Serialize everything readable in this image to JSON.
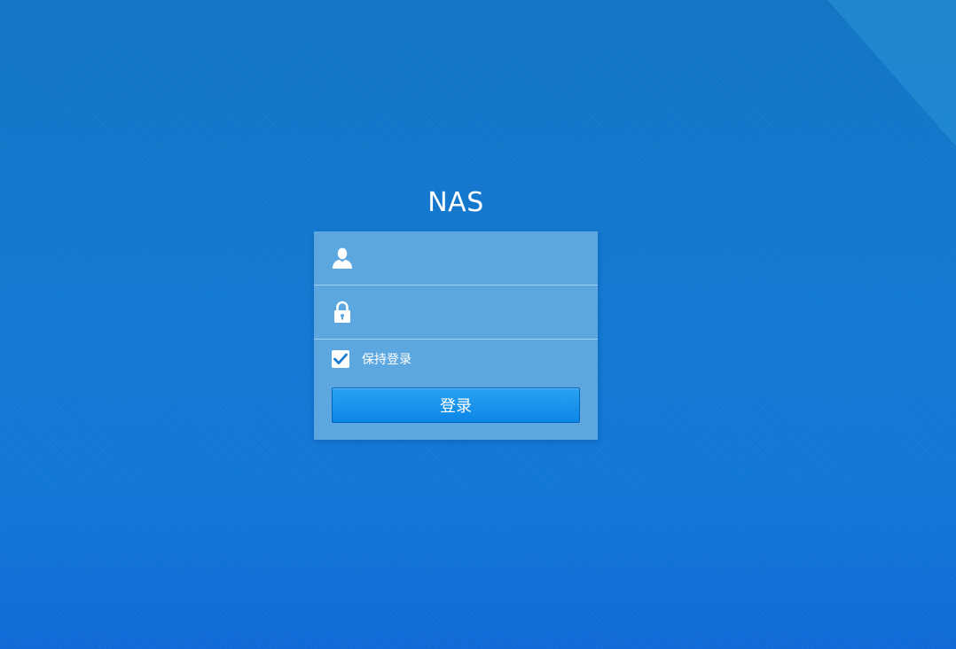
{
  "app": {
    "title": "NAS"
  },
  "login_form": {
    "username": {
      "value": "",
      "placeholder": "",
      "icon": "user-icon"
    },
    "password": {
      "value": "",
      "placeholder": "",
      "icon": "lock-icon"
    },
    "remember_me": {
      "label": "保持登录",
      "checked": true,
      "icon": "checkmark-icon"
    },
    "submit_label": "登录"
  },
  "colors": {
    "background": "#1377d0",
    "panel": "#5ca7df",
    "button": "#0a86e6",
    "checkmark": "#1a7ad0",
    "text": "#ffffff"
  }
}
